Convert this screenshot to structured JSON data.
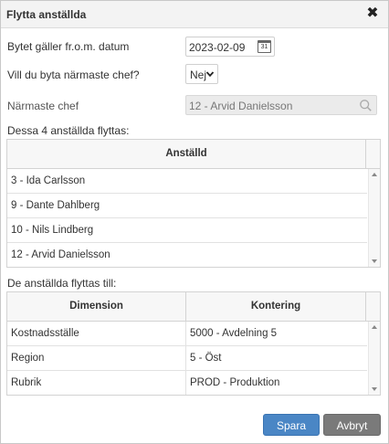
{
  "dialog": {
    "title": "Flytta anställda",
    "close_glyph": "✖"
  },
  "form": {
    "date_label": "Bytet gäller fr.o.m. datum",
    "date_value": "2023-02-09",
    "calendar_day": "31",
    "change_chief_label": "Vill du byta närmaste chef?",
    "change_chief_value": "Nej",
    "chief_label": "Närmaste chef",
    "chief_value": "12 - Arvid Danielsson"
  },
  "employees": {
    "caption": "Dessa 4 anställda flyttas:",
    "column": "Anställd",
    "rows": [
      "3 - Ida Carlsson",
      "9 - Dante Dahlberg",
      "10 - Nils Lindberg",
      "12 - Arvid Danielsson"
    ]
  },
  "destination": {
    "caption": "De anställda flyttas till:",
    "columns": [
      "Dimension",
      "Kontering"
    ],
    "rows": [
      {
        "dimension": "Kostnadsställe",
        "kontering": "5000 - Avdelning 5"
      },
      {
        "dimension": "Region",
        "kontering": "5 - Öst"
      },
      {
        "dimension": "Rubrik",
        "kontering": "PROD - Produktion"
      }
    ]
  },
  "actions": {
    "save": "Spara",
    "cancel": "Avbryt"
  },
  "colors": {
    "primary_button": "#4a86c5",
    "secondary_button": "#7a7a7a"
  },
  "icons": {
    "close": "close-icon",
    "calendar": "calendar-icon",
    "dropdown": "chevron-down-icon",
    "search": "search-icon"
  }
}
